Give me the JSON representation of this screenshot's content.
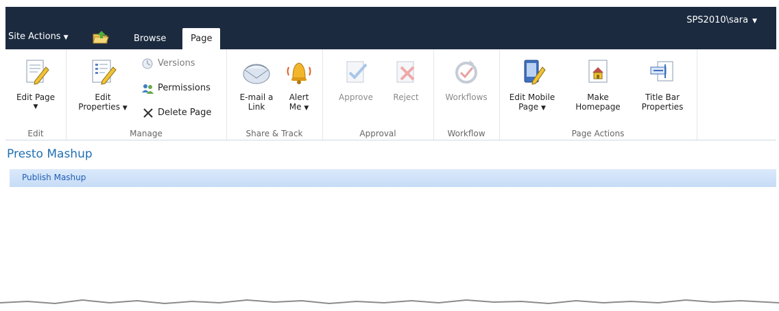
{
  "topbar": {
    "site_actions": "Site Actions",
    "tabs": [
      "Browse",
      "Page"
    ],
    "user": "SPS2010\\sara"
  },
  "ribbon": {
    "groups": {
      "edit": {
        "label": "Edit",
        "edit_page": "Edit Page"
      },
      "manage": {
        "label": "Manage",
        "edit_properties_line1": "Edit",
        "edit_properties_line2": "Properties",
        "versions": "Versions",
        "permissions": "Permissions",
        "delete_page": "Delete Page"
      },
      "share_track": {
        "label": "Share & Track",
        "email_line1": "E-mail a",
        "email_line2": "Link",
        "alert_line1": "Alert",
        "alert_line2": "Me"
      },
      "approval": {
        "label": "Approval",
        "approve": "Approve",
        "reject": "Reject"
      },
      "workflow": {
        "label": "Workflow",
        "workflows": "Workflows"
      },
      "page_actions": {
        "label": "Page Actions",
        "edit_mobile_line1": "Edit Mobile",
        "edit_mobile_line2": "Page",
        "make_home_line1": "Make",
        "make_home_line2": "Homepage",
        "title_bar_line1": "Title Bar",
        "title_bar_line2": "Properties"
      }
    }
  },
  "content": {
    "title": "Presto Mashup",
    "nav_item": "Publish Mashup"
  },
  "colors": {
    "topbar": "#1b2a3f",
    "link_blue": "#1f6fb2",
    "nav_bg": "#c6dcf6"
  }
}
